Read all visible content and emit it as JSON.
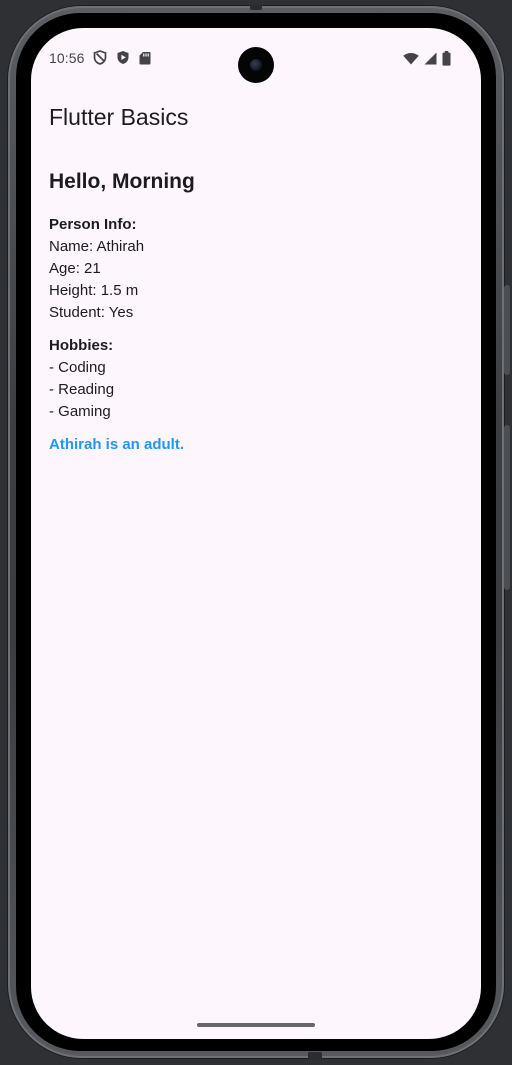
{
  "status_bar": {
    "time": "10:56",
    "left_icons": [
      "vpn-shield-icon",
      "play-protect-icon",
      "sd-card-icon"
    ],
    "right_icons": [
      "wifi-icon",
      "cell-signal-icon",
      "battery-icon"
    ]
  },
  "app_bar": {
    "title": "Flutter Basics"
  },
  "main": {
    "greeting": "Hello, Morning",
    "person_info": {
      "heading": "Person Info:",
      "name": "Name: Athirah",
      "age": "Age: 21",
      "height": "Height: 1.5 m",
      "student": "Student: Yes"
    },
    "hobbies": {
      "heading": "Hobbies:",
      "items": [
        "- Coding",
        "- Reading",
        "- Gaming"
      ]
    },
    "adult_note": "Athirah is an adult."
  },
  "colors": {
    "background": "#fdf7fd",
    "text": "#1d1b20",
    "accent": "#2196f3"
  }
}
